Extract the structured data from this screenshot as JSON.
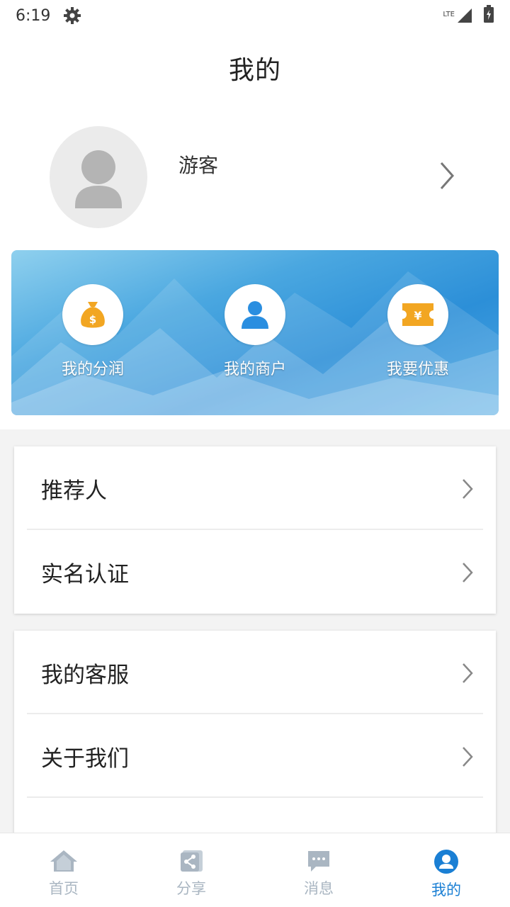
{
  "status_bar": {
    "time": "6:19",
    "network": "LTE"
  },
  "header": {
    "title": "我的"
  },
  "profile": {
    "username": "游客"
  },
  "quick_actions": [
    {
      "label": "我的分润",
      "icon": "money-bag-icon"
    },
    {
      "label": "我的商户",
      "icon": "person-icon"
    },
    {
      "label": "我要优惠",
      "icon": "coupon-icon"
    }
  ],
  "menu_group_1": [
    {
      "label": "推荐人"
    },
    {
      "label": "实名认证"
    }
  ],
  "menu_group_2": [
    {
      "label": "我的客服"
    },
    {
      "label": "关于我们"
    }
  ],
  "tabs": [
    {
      "label": "首页",
      "icon": "home-icon",
      "active": false
    },
    {
      "label": "分享",
      "icon": "share-icon",
      "active": false
    },
    {
      "label": "消息",
      "icon": "message-icon",
      "active": false
    },
    {
      "label": "我的",
      "icon": "user-icon",
      "active": true
    }
  ],
  "colors": {
    "accent": "#1a7fd4",
    "icon_gold": "#f2a622",
    "icon_blue": "#2a8ee0",
    "tab_inactive": "#aab6c2"
  }
}
